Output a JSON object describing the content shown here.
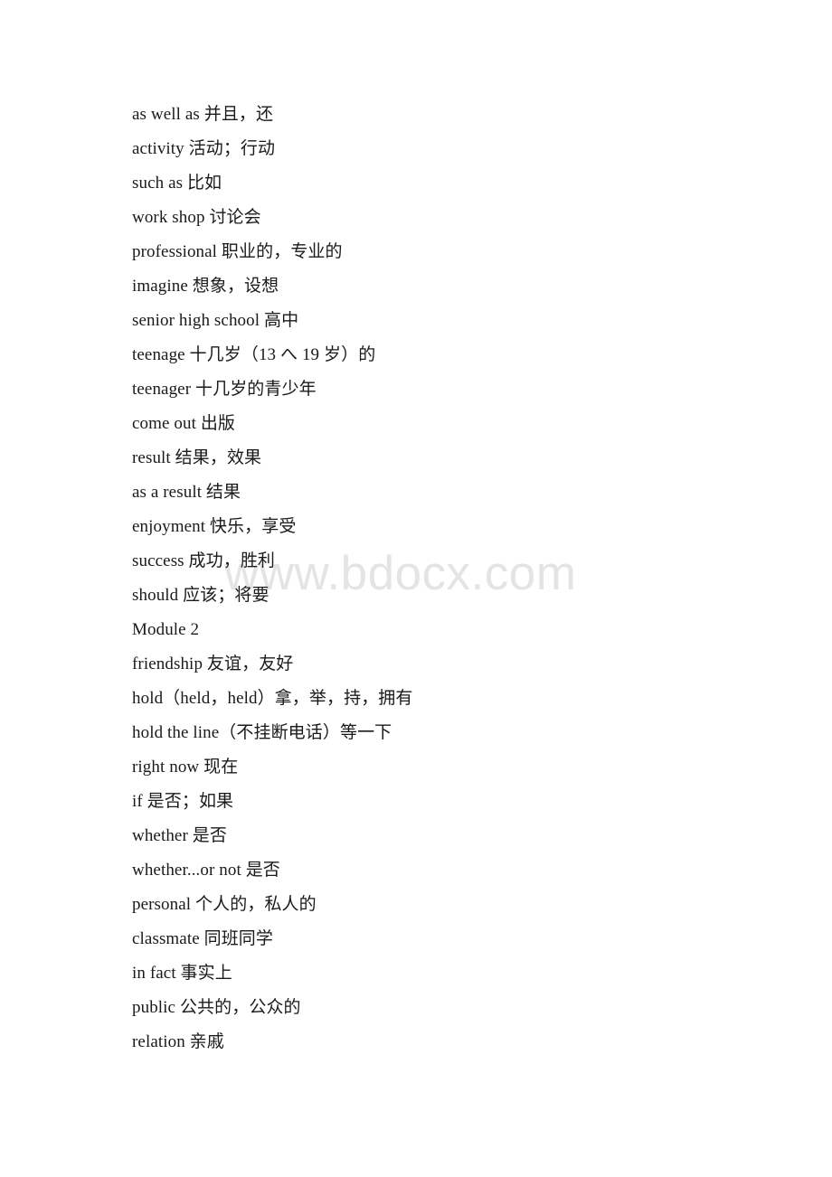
{
  "document": {
    "background_color": "#ffffff",
    "text_color": "#1a1a1a",
    "watermark": {
      "text": "www.bdocx.com",
      "color": "#e4e4e4"
    },
    "lines": [
      {
        "id": "as-well-as",
        "text": "as well as 并且，还"
      },
      {
        "id": "activity",
        "text": "activity 活动；行动"
      },
      {
        "id": "such-as",
        "text": "such as 比如"
      },
      {
        "id": "work-shop",
        "text": "work shop 讨论会"
      },
      {
        "id": "professional",
        "text": "professional 职业的，专业的"
      },
      {
        "id": "imagine",
        "text": "imagine 想象，设想"
      },
      {
        "id": "senior-high-school",
        "text": "senior high school 高中"
      },
      {
        "id": "teenage",
        "text": "teenage 十几岁（13 へ 19 岁）的"
      },
      {
        "id": "teenager",
        "text": "teenager 十几岁的青少年"
      },
      {
        "id": "come-out",
        "text": "come out 出版"
      },
      {
        "id": "result",
        "text": "result 结果，效果"
      },
      {
        "id": "as-a-result",
        "text": "as a result 结果"
      },
      {
        "id": "enjoyment",
        "text": "enjoyment 快乐，享受"
      },
      {
        "id": "success",
        "text": "success 成功，胜利"
      },
      {
        "id": "should",
        "text": "should 应该；将要"
      },
      {
        "id": "module-2",
        "text": "Module 2",
        "heading": true
      },
      {
        "id": "friendship",
        "text": "friendship 友谊，友好"
      },
      {
        "id": "hold",
        "text": "hold（held，held）拿，举，持，拥有"
      },
      {
        "id": "hold-the-line",
        "text": "hold the line（不挂断电话）等一下"
      },
      {
        "id": "right-now",
        "text": "right now 现在"
      },
      {
        "id": "if",
        "text": "if 是否；如果"
      },
      {
        "id": "whether",
        "text": "whether 是否"
      },
      {
        "id": "whether-or-not",
        "text": "whether...or not 是否"
      },
      {
        "id": "personal",
        "text": "personal 个人的，私人的"
      },
      {
        "id": "classmate",
        "text": "classmate 同班同学"
      },
      {
        "id": "in-fact",
        "text": "in fact 事实上"
      },
      {
        "id": "public",
        "text": "public 公共的，公众的"
      },
      {
        "id": "relation",
        "text": "relation 亲戚"
      }
    ]
  }
}
